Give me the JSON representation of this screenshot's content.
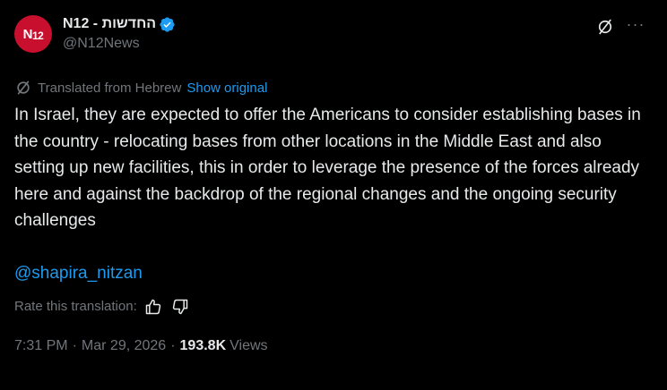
{
  "author": {
    "display_name": "החדשות - N12",
    "handle": "@N12News",
    "avatar_text": "N",
    "avatar_num": "12",
    "avatar_color": "#c8102e",
    "verified_color": "#1d9bf0"
  },
  "header_icons": [
    "grok-slash-icon",
    "more-icon"
  ],
  "more_label": "···",
  "translation": {
    "label": "Translated from Hebrew",
    "show_original": "Show original"
  },
  "tweet": {
    "text": "In Israel, they are expected to offer the Americans to consider establishing bases in the country - relocating bases from other locations in the Middle East and also setting up new facilities, this in order to leverage the presence of the forces already here and against the backdrop of the regional changes and the ongoing security challenges",
    "mention": "@shapira_nitzan"
  },
  "rating": {
    "label": "Rate this translation:"
  },
  "meta": {
    "time": "7:31 PM",
    "date": "Mar 29, 2026",
    "views_count": "193.8K",
    "views_label": "Views"
  },
  "colors": {
    "background": "#000000",
    "text": "#e7e9ea",
    "muted": "#71767b",
    "link": "#1d9bf0"
  }
}
